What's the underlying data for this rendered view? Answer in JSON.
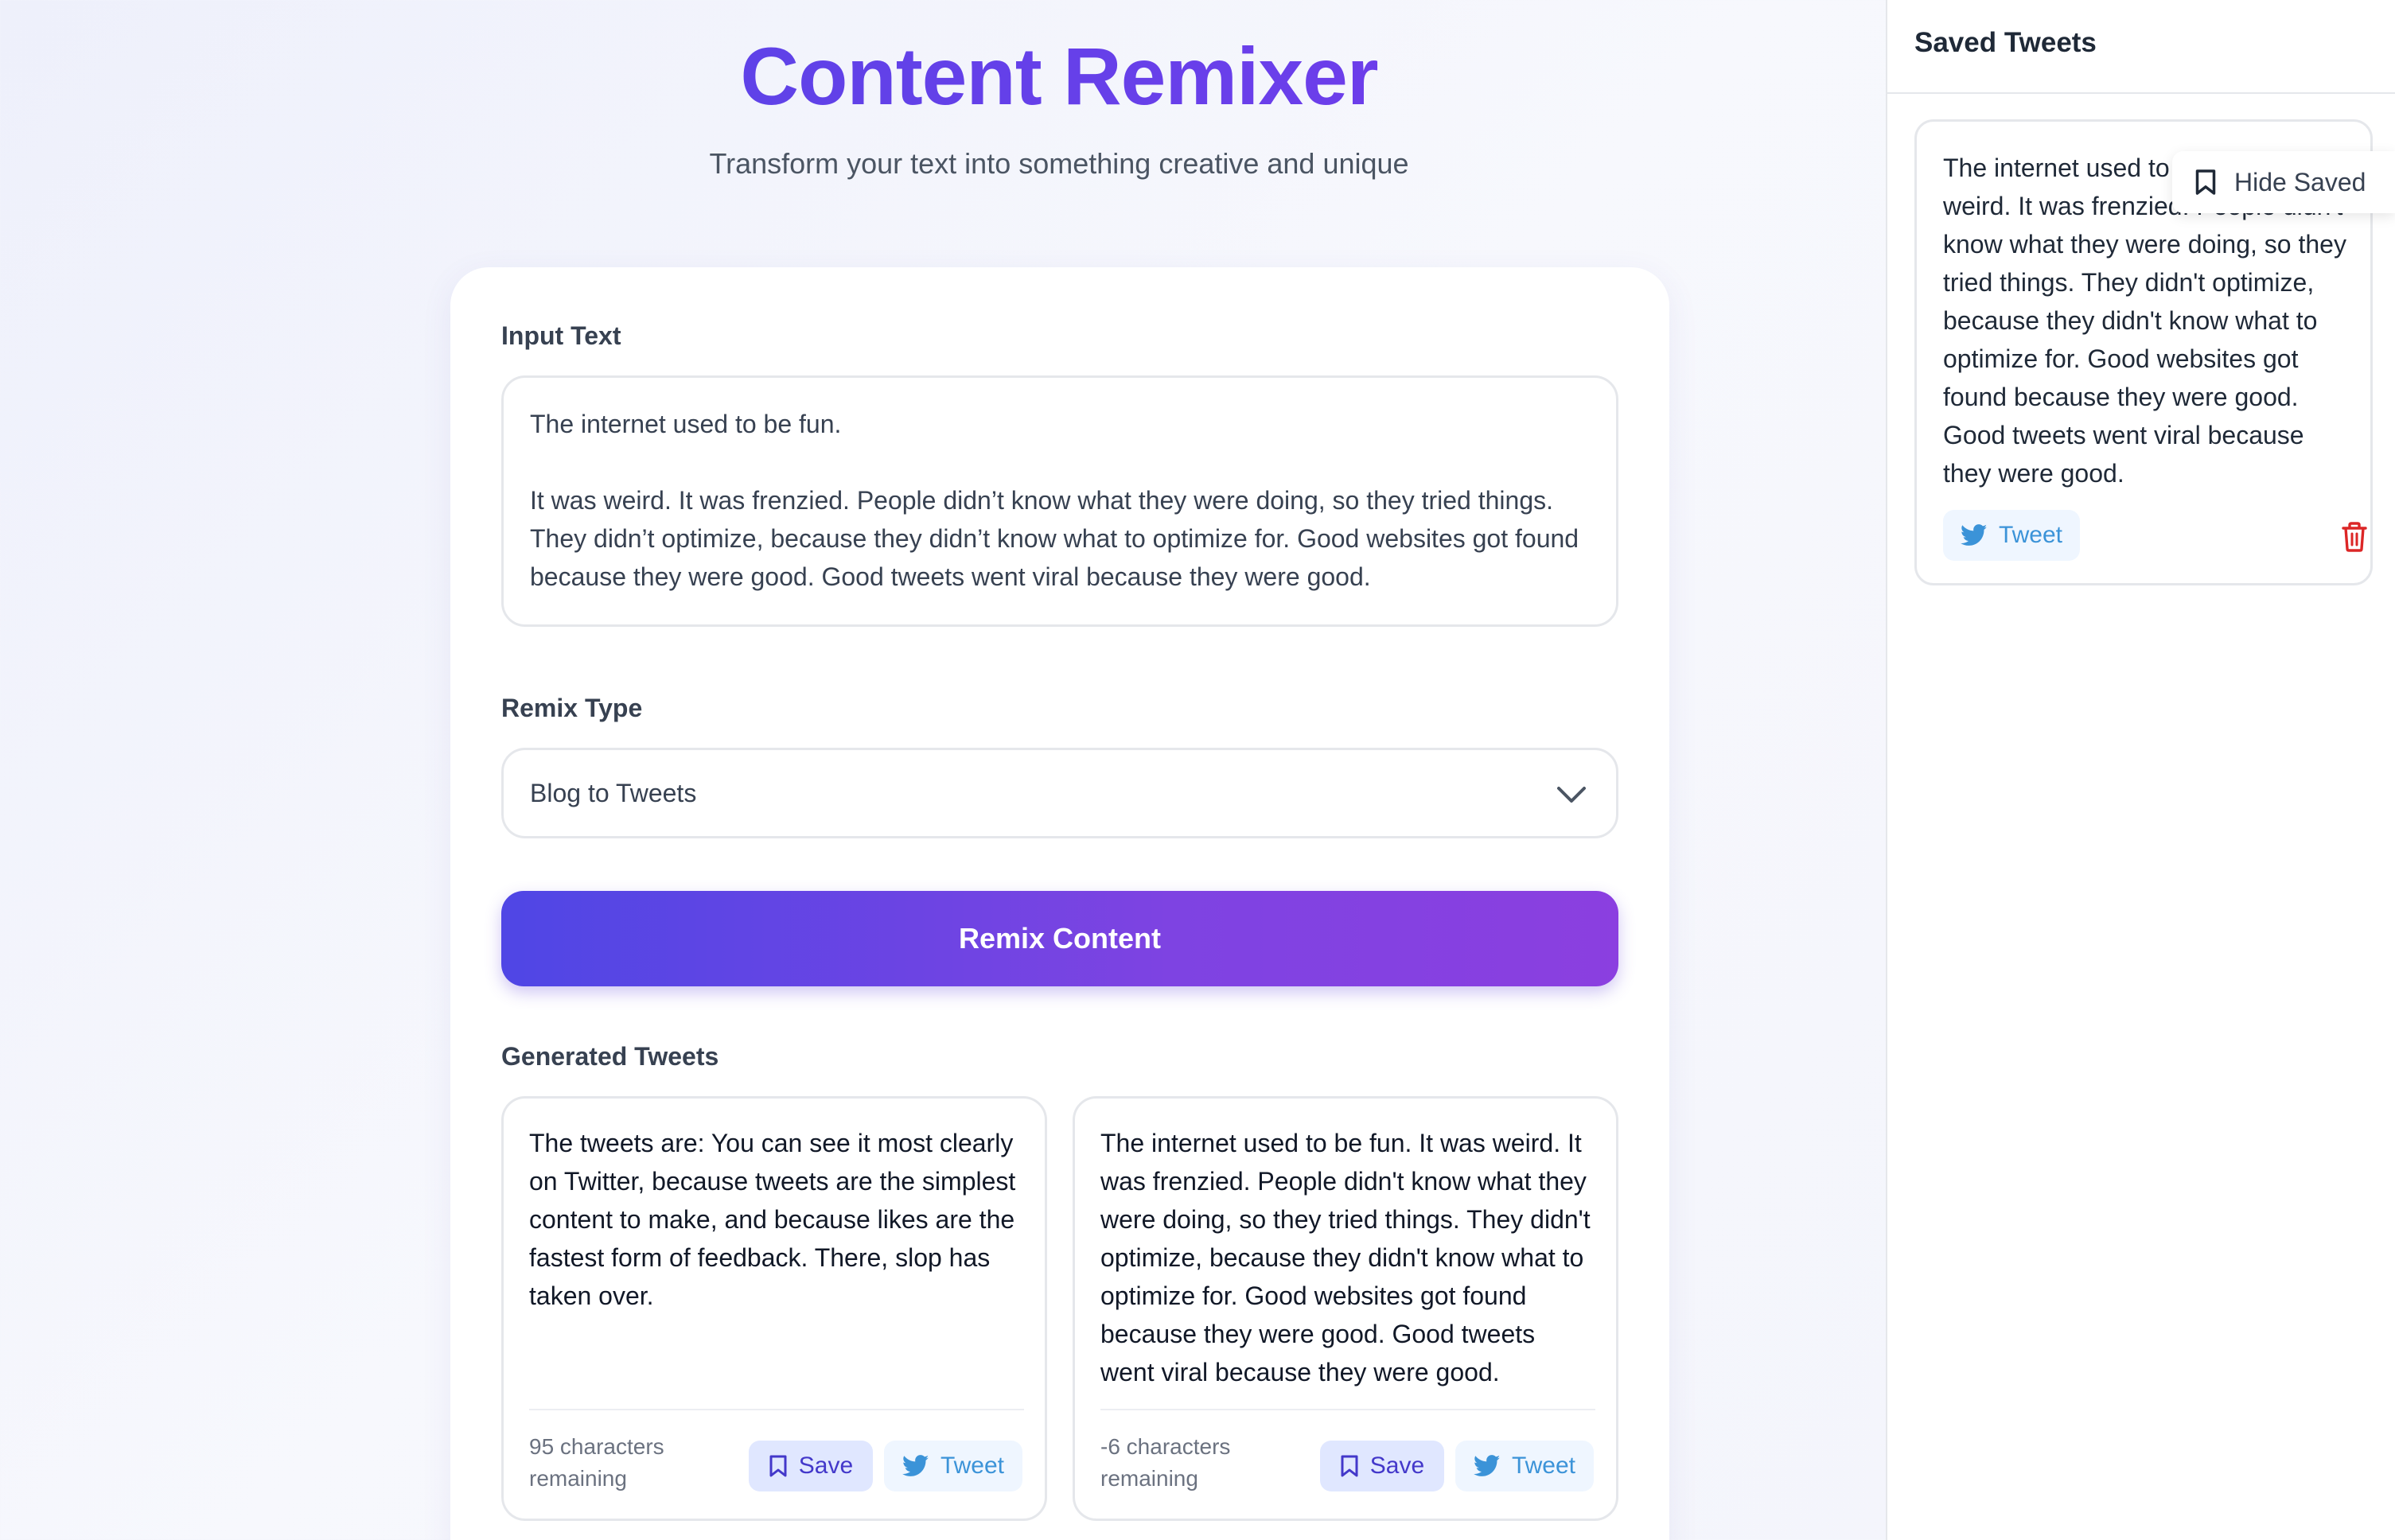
{
  "app": {
    "title": "Content Remixer",
    "subtitle": "Transform your text into something creative and unique"
  },
  "form": {
    "input_label": "Input Text",
    "input_value": "The internet used to be fun.\n\nIt was weird. It was frenzied. People didn’t know what they were doing, so they tried things. They didn’t optimize, because they didn’t know what to optimize for. Good websites got found because they were good. Good tweets went viral because they were good.",
    "remix_label": "Remix Type",
    "remix_selected": "Blog to Tweets",
    "remix_button": "Remix Content"
  },
  "generated": {
    "label": "Generated Tweets",
    "tweets": [
      {
        "text": "The tweets are: You can see it most clearly on Twitter, because tweets are the simplest content to make, and because likes are the fastest form of feedback. There, slop has taken over.",
        "remaining": "95 characters remaining",
        "save_label": "Save",
        "tweet_label": "Tweet"
      },
      {
        "text": "The internet used to be fun. It was weird. It was frenzied. People didn't know what they were doing, so they tried things. They didn't optimize, because they didn't know what to optimize for. Good websites got found because they were good. Good tweets went viral because they were good.",
        "remaining": "-6 characters remaining",
        "save_label": "Save",
        "tweet_label": "Tweet"
      }
    ]
  },
  "saved": {
    "title": "Saved Tweets",
    "items": [
      {
        "text": "The internet used to be fun. It was weird. It was frenzied. People didn't know what they were doing, so they tried things. They didn't optimize, because they didn't know what to optimize for. Good websites got found because they were good. Good tweets went viral because they were good.",
        "tweet_label": "Tweet"
      }
    ],
    "toggle_label": "Hide Saved"
  },
  "colors": {
    "accent_start": "#4f46e5",
    "accent_end": "#8b3fe0",
    "twitter_blue": "#3b93d8",
    "danger": "#dc2626"
  },
  "icons": {
    "select": "chevron-down-icon",
    "save": "bookmark-icon",
    "tweet": "twitter-bird-icon",
    "delete": "trash-icon",
    "toggle": "bookmark-icon"
  }
}
